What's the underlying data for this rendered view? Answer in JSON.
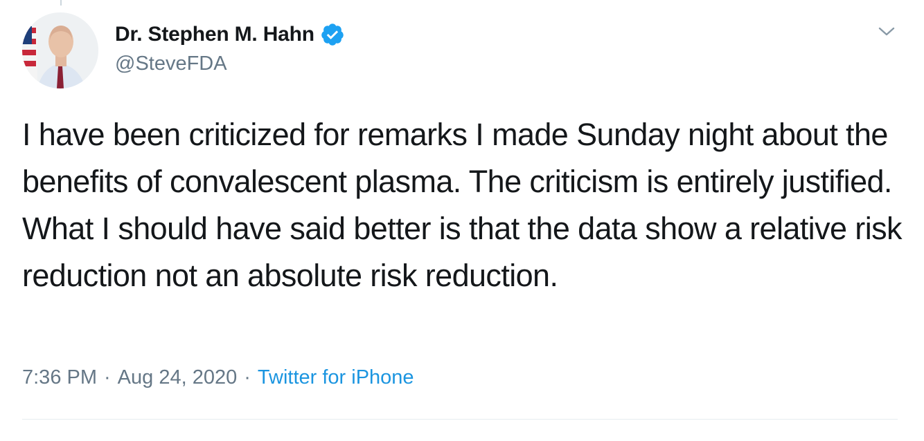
{
  "author": {
    "display_name": "Dr. Stephen M. Hahn",
    "handle": "@SteveFDA",
    "verified": true,
    "verified_color": "#1da1f2",
    "avatar_icon": "profile-photo"
  },
  "tweet": {
    "text": "I have been criticized for remarks I made Sunday night about the benefits of convalescent plasma. The criticism is entirely justified.  What I should have said better is that the data show a relative risk reduction not an absolute risk reduction."
  },
  "meta": {
    "time": "7:36 PM",
    "separator": "·",
    "date": "Aug 24, 2020",
    "source": "Twitter for iPhone"
  },
  "colors": {
    "text": "#14171a",
    "secondary": "#657786",
    "link": "#1b95e0",
    "divider": "#e6ecf0"
  },
  "icons": {
    "verified": "verified-badge-icon",
    "menu": "chevron-down-icon"
  }
}
